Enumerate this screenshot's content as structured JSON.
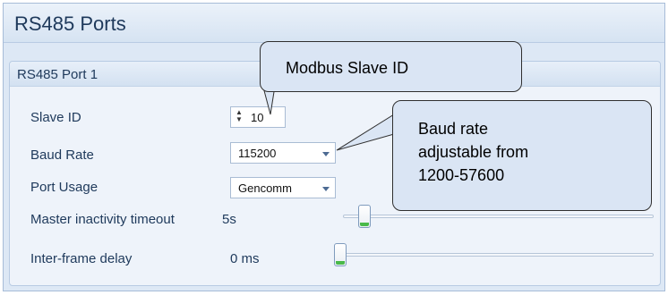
{
  "window": {
    "title": "RS485 Ports"
  },
  "group": {
    "title": "RS485 Port 1"
  },
  "fields": {
    "slave_id": {
      "label": "Slave ID",
      "value": "10"
    },
    "baud_rate": {
      "label": "Baud Rate",
      "value": "115200"
    },
    "port_usage": {
      "label": "Port Usage",
      "value": "Gencomm"
    },
    "master_inactivity": {
      "label": "Master inactivity timeout",
      "value": "5s",
      "slider_fraction": 0.05
    },
    "inter_frame_delay": {
      "label": "Inter-frame delay",
      "value": "0 ms",
      "slider_fraction": 0.0
    }
  },
  "callouts": {
    "slave_id_note": {
      "text": "Modbus Slave ID"
    },
    "baud_note": {
      "lines": [
        "Baud rate",
        "adjustable from",
        "1200-57600"
      ]
    }
  },
  "icons": {
    "spin_arrows": "up-down-arrows-icon",
    "dropdown": "chevron-down-icon"
  },
  "colors": {
    "panel_bg": "#dde8f5",
    "callout_bg": "#dae5f4",
    "slider_accent": "#49b949"
  }
}
